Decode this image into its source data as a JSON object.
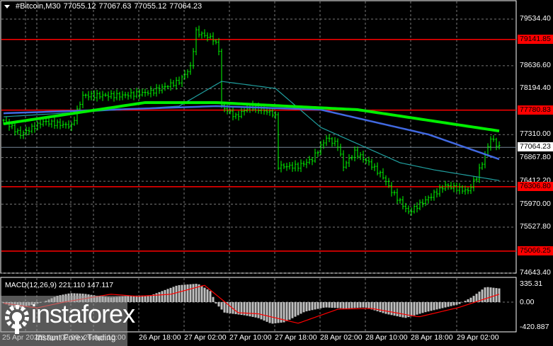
{
  "header": {
    "symbol": "#Bitcoin,M30",
    "open": "77055.12",
    "high": "77067.63",
    "low": "77055.12",
    "close": "77064.23"
  },
  "price_axis": {
    "ticks": [
      "79534.40",
      "78636.60",
      "78194.40",
      "77310.00",
      "76867.80",
      "76412.20",
      "75970.00",
      "75527.80",
      "74643.40"
    ],
    "tick_values": [
      79534.4,
      78636.6,
      78194.4,
      77310.0,
      76867.8,
      76412.2,
      75970.0,
      75527.8,
      74643.4
    ]
  },
  "levels": [
    {
      "label": "79141.85",
      "value": 79141.85
    },
    {
      "label": "77780.83",
      "value": 77780.83
    },
    {
      "label": "76306.80",
      "value": 76306.8
    },
    {
      "label": "75066.25",
      "value": 75066.25
    }
  ],
  "current_price": {
    "label": "77064.23",
    "value": 77064.23
  },
  "time_axis": [
    "25 Apr 2026",
    "26 Apr 02:00",
    "26 Apr 10:00",
    "26 Apr 18:00",
    "27 Apr 02:00",
    "27 Apr 10:00",
    "27 Apr 18:00",
    "28 Apr 02:00",
    "28 Apr 10:00",
    "28 Apr 18:00",
    "29 Apr 02:00"
  ],
  "macd": {
    "title": "MACD(12,26,9) 221.110 147.117",
    "max_label": "335.31",
    "zero_label": "0.00",
    "min_label": "-420.887",
    "hist_keys": [
      [
        0,
        -20
      ],
      [
        10,
        -120
      ],
      [
        20,
        -60
      ],
      [
        30,
        5
      ],
      [
        40,
        120
      ],
      [
        50,
        170
      ],
      [
        60,
        160
      ],
      [
        70,
        120
      ],
      [
        80,
        90
      ],
      [
        95,
        120
      ],
      [
        110,
        130
      ],
      [
        130,
        320
      ],
      [
        145,
        350
      ],
      [
        155,
        200
      ],
      [
        158,
        -10
      ],
      [
        165,
        -200
      ],
      [
        180,
        -250
      ],
      [
        190,
        -300
      ],
      [
        200,
        -410
      ],
      [
        210,
        -380
      ],
      [
        225,
        -180
      ],
      [
        240,
        -100
      ],
      [
        255,
        -120
      ],
      [
        270,
        -100
      ],
      [
        285,
        -220
      ],
      [
        300,
        -300
      ],
      [
        315,
        -190
      ],
      [
        330,
        -100
      ],
      [
        340,
        -40
      ],
      [
        350,
        100
      ],
      [
        360,
        290
      ],
      [
        370,
        260
      ]
    ],
    "signal_keys": [
      [
        0,
        -20
      ],
      [
        25,
        -110
      ],
      [
        45,
        0
      ],
      [
        80,
        150
      ],
      [
        100,
        110
      ],
      [
        125,
        150
      ],
      [
        150,
        320
      ],
      [
        175,
        -200
      ],
      [
        190,
        -220
      ],
      [
        220,
        -400
      ],
      [
        250,
        -130
      ],
      [
        275,
        -120
      ],
      [
        310,
        -280
      ],
      [
        340,
        -100
      ],
      [
        370,
        150
      ]
    ]
  },
  "chart_data": {
    "type": "candlestick",
    "timeframe": "M30",
    "close_keys": [
      [
        0,
        77585
      ],
      [
        6,
        77313
      ],
      [
        14,
        77558
      ],
      [
        24,
        77476
      ],
      [
        28,
        78062
      ],
      [
        42,
        78062
      ],
      [
        52,
        78130
      ],
      [
        62,
        78335
      ],
      [
        66,
        78607
      ],
      [
        68,
        79289
      ],
      [
        74,
        79152
      ],
      [
        76,
        78948
      ],
      [
        77,
        77858
      ],
      [
        82,
        77653
      ],
      [
        87,
        77858
      ],
      [
        95,
        77721
      ],
      [
        96,
        77653
      ],
      [
        97,
        76699
      ],
      [
        104,
        76699
      ],
      [
        109,
        76836
      ],
      [
        114,
        77245
      ],
      [
        118,
        77108
      ],
      [
        120,
        76699
      ],
      [
        124,
        76972
      ],
      [
        129,
        76768
      ],
      [
        134,
        76495
      ],
      [
        137,
        76222
      ],
      [
        142,
        75882
      ],
      [
        143,
        75814
      ],
      [
        150,
        76086
      ],
      [
        156,
        76331
      ],
      [
        164,
        76222
      ],
      [
        167,
        76495
      ],
      [
        170,
        76904
      ],
      [
        172,
        77245
      ],
      [
        175,
        77064
      ]
    ],
    "ma_green": [
      [
        0,
        77517
      ],
      [
        50,
        77927
      ],
      [
        75,
        77927
      ],
      [
        100,
        77858
      ],
      [
        125,
        77790
      ],
      [
        150,
        77585
      ],
      [
        175,
        77380
      ]
    ],
    "ma_blue": [
      [
        0,
        77721
      ],
      [
        75,
        77858
      ],
      [
        112,
        77790
      ],
      [
        150,
        77313
      ],
      [
        175,
        76836
      ]
    ],
    "ma_teal": [
      [
        0,
        77653
      ],
      [
        62,
        77858
      ],
      [
        77,
        78335
      ],
      [
        96,
        78199
      ],
      [
        112,
        77449
      ],
      [
        140,
        76768
      ],
      [
        152,
        76631
      ],
      [
        175,
        76426
      ]
    ]
  },
  "watermark": {
    "name": "instaforex",
    "tagline": "Instant Forex Trading"
  },
  "colors": {
    "bars": "#00ff00",
    "levels": "#ff0000",
    "ma_green": "#00ee00",
    "ma_blue": "#4169e1",
    "ma_teal": "#20a0a0",
    "signal": "#ff0000",
    "hist": "#c0c0c0"
  }
}
